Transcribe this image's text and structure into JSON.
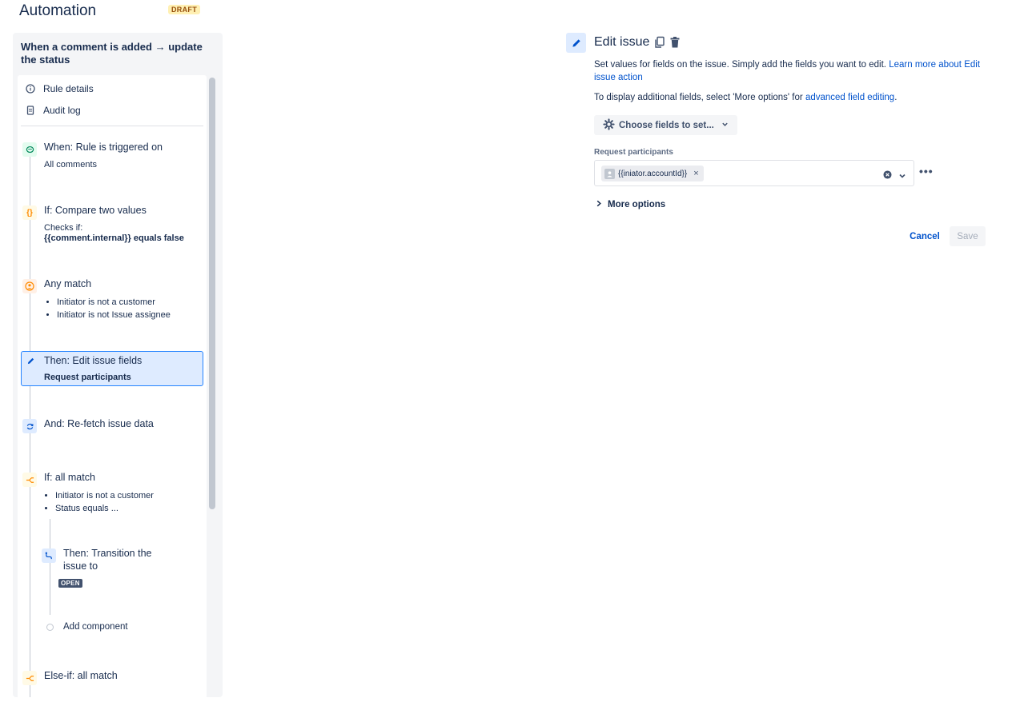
{
  "header": {
    "title": "Automation",
    "badge": "DRAFT"
  },
  "rule": {
    "name": "When a comment is added → update the status",
    "menu": [
      {
        "label": "Rule details",
        "icon": "info-icon"
      },
      {
        "label": "Audit log",
        "icon": "document-icon"
      }
    ],
    "steps": {
      "trigger": {
        "title": "When: Rule is triggered on",
        "sub": "All comments"
      },
      "compare": {
        "title": "If: Compare two values",
        "sub1": "Checks if:",
        "sub2": "{{comment.internal}} equals false"
      },
      "anymatch": {
        "title": "Any match",
        "bullets": [
          "Initiator is not a customer",
          "Initiator is not Issue assignee"
        ]
      },
      "edit": {
        "title": "Then: Edit issue fields",
        "sub": "Request participants"
      },
      "refetch": {
        "title": "And: Re-fetch issue data"
      },
      "allmatch": {
        "title": "If: all match",
        "bullets": [
          "Initiator is not a customer",
          "Status equals ..."
        ]
      },
      "transition": {
        "title_line1": "Then: Transition the",
        "title_line2": "issue to",
        "status": "OPEN"
      },
      "add_component": "Add component",
      "elseif": {
        "title": "Else-if: all match"
      }
    }
  },
  "editor": {
    "title": "Edit issue",
    "description": "Set values for fields on the issue. Simply add the fields you want to edit.",
    "learn_more": "Learn more about Edit issue action",
    "additional_prefix": "To display additional fields, select 'More options' for",
    "additional_link": "advanced field editing",
    "additional_suffix": ".",
    "choose_fields": "Choose fields to set...",
    "field_label": "Request participants",
    "chip_value": "{{iniator.accountId}}",
    "more_options": "More options",
    "cancel": "Cancel",
    "save": "Save"
  },
  "colors": {
    "accent": "#0052cc",
    "selected_bg": "#deebff",
    "selected_border": "#2684ff"
  }
}
